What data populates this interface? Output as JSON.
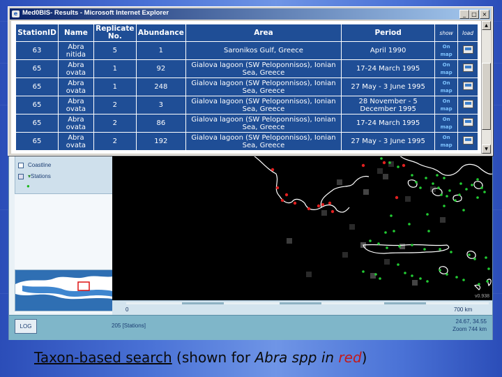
{
  "window": {
    "title": "Med0BIS- Results - Microsoft Internet Explorer",
    "minimize": "_",
    "maximize": "□",
    "close": "×"
  },
  "table": {
    "headers": [
      "StationID",
      "Name",
      "Replicate No.",
      "Abundance",
      "Area",
      "Period",
      "show",
      "load"
    ],
    "rows": [
      {
        "station": "63",
        "name": "Abra nitida",
        "replicate": "5",
        "abundance": "1",
        "area": "Saronikos Gulf, Greece",
        "period": "April 1990",
        "show": "On map"
      },
      {
        "station": "65",
        "name": "Abra ovata",
        "replicate": "1",
        "abundance": "92",
        "area": "Gialova lagoon (SW Peloponnisos), Ionian Sea, Greece",
        "period": "17-24 March 1995",
        "show": "On map"
      },
      {
        "station": "65",
        "name": "Abra ovata",
        "replicate": "1",
        "abundance": "248",
        "area": "Gialova lagoon (SW Peloponnisos), Ionian Sea, Greece",
        "period": "27 May - 3 June 1995",
        "show": "On map"
      },
      {
        "station": "65",
        "name": "Abra ovata",
        "replicate": "2",
        "abundance": "3",
        "area": "Gialova lagoon (SW Peloponnisos), Ionian Sea, Greece",
        "period": "28 November - 5 December 1995",
        "show": "On map"
      },
      {
        "station": "65",
        "name": "Abra ovata",
        "replicate": "2",
        "abundance": "86",
        "area": "Gialova lagoon (SW Peloponnisos), Ionian Sea, Greece",
        "period": "17-24 March 1995",
        "show": "On map"
      },
      {
        "station": "65",
        "name": "Abra ovata",
        "replicate": "2",
        "abundance": "192",
        "area": "Gialova lagoon (SW Peloponnisos), Ionian Sea, Greece",
        "period": "27 May - 3 June 1995",
        "show": "On map"
      }
    ]
  },
  "gis": {
    "layers": [
      "Coastline",
      "Stations"
    ],
    "scale_start": "0",
    "scale_end": "700 km",
    "version": "v0.938",
    "log_button": "LOG",
    "station_count": "205 [Stations]",
    "coords": "24.67, 34.55",
    "zoom": "Zoom 744 km"
  },
  "caption": {
    "part1": "Taxon-based search",
    "part2": " (shown for ",
    "part3": "Abra spp in ",
    "part4": "red",
    "part5": ")"
  },
  "colors": {
    "header_blue": "#1f4e96",
    "coastline": "#ffffff",
    "taxon_highlight": "#e02020",
    "other_stations": "#22cc33"
  }
}
